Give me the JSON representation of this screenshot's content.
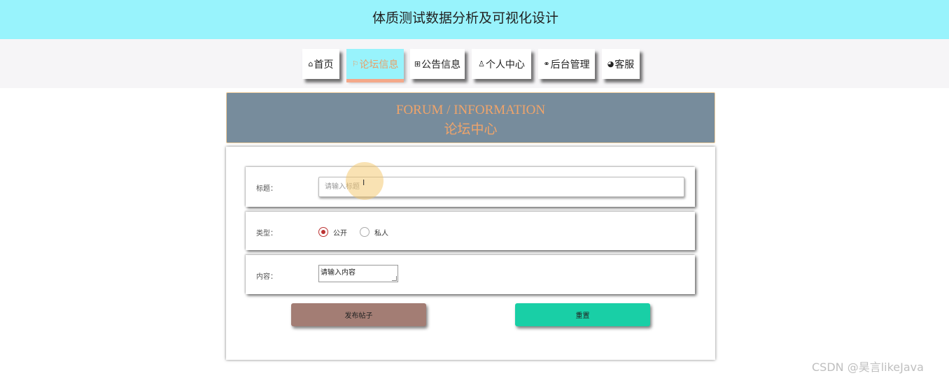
{
  "header": {
    "title": "体质测试数据分析及可视化设计"
  },
  "nav": {
    "items": [
      {
        "icon": "⌂",
        "icon_name": "home-icon",
        "label": "首页"
      },
      {
        "icon": "⚐",
        "icon_name": "flag-icon",
        "label": "论坛信息"
      },
      {
        "icon": "⊞",
        "icon_name": "notice-icon",
        "label": "公告信息"
      },
      {
        "icon": "♙",
        "icon_name": "user-icon",
        "label": "个人中心"
      },
      {
        "icon": "⚭",
        "icon_name": "link-icon",
        "label": "后台管理"
      },
      {
        "icon": "◕",
        "icon_name": "service-icon",
        "label": "客服"
      }
    ],
    "active_index": 1
  },
  "banner": {
    "en": "FORUM / INFORMATION",
    "cn": "论坛中心"
  },
  "form": {
    "title_label": "标题：",
    "title_placeholder": "请输入标题",
    "type_label": "类型：",
    "type_options": [
      "公开",
      "私人"
    ],
    "type_selected": "公开",
    "content_label": "内容：",
    "content_value": "请输入内容",
    "submit_label": "发布帖子",
    "reset_label": "重置"
  },
  "watermark": "CSDN @昊言likeJava",
  "colors": {
    "header_bg": "#98f3fc",
    "banner_bg": "#778c9c",
    "banner_text": "#f0a46a",
    "submit_bg": "#a37d74",
    "reset_bg": "#19cfa6"
  }
}
